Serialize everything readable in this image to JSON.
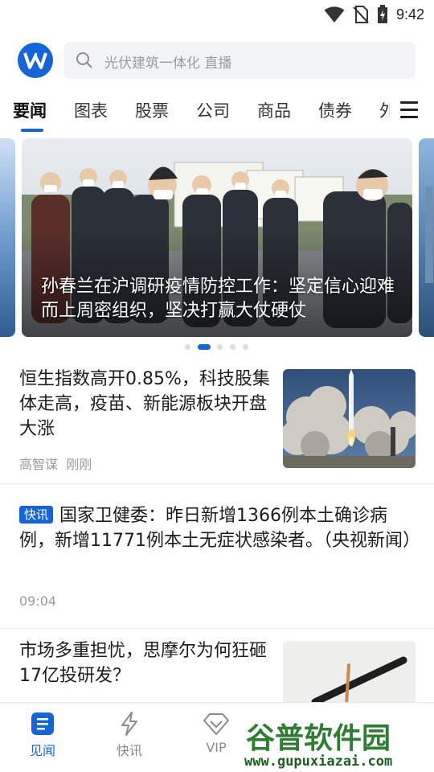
{
  "status_bar": {
    "time": "9:42"
  },
  "header": {
    "search_placeholder": "光伏建筑一体化 直播"
  },
  "tabs": [
    {
      "label": "要闻",
      "active": true
    },
    {
      "label": "图表"
    },
    {
      "label": "股票"
    },
    {
      "label": "公司"
    },
    {
      "label": "商品"
    },
    {
      "label": "债券"
    },
    {
      "label": "外"
    }
  ],
  "carousel": {
    "caption": "孙春兰在沪调研疫情防控工作：坚定信心迎难而上周密组织，坚决打赢大仗硬仗",
    "active_index": 1,
    "count": 5
  },
  "articles": [
    {
      "title": "恒生指数高开0.85%，科技股集体走高，疫苗、新能源板块开盘大涨",
      "author": "高智谋",
      "time": "刚刚",
      "thumb": "rocket-launch"
    },
    {
      "badge": "快讯",
      "title": "国家卫健委：昨日新增1366例本土确诊病例，新增11771例本土无症状感染者。（央视新闻）",
      "time": "09:04"
    },
    {
      "title": "市场多重担忧，思摩尔为何狂砸17亿投研发？",
      "thumb": "e-cigarette"
    }
  ],
  "bottom_nav": [
    {
      "label": "见闻",
      "icon": "document-icon",
      "active": true
    },
    {
      "label": "快讯",
      "icon": "lightning-icon"
    },
    {
      "label": "VIP",
      "icon": "diamond-icon"
    }
  ],
  "watermark": {
    "brand": "谷普软件园",
    "url": "www.gupuxiazai.com"
  },
  "colors": {
    "accent": "#1565d8"
  }
}
